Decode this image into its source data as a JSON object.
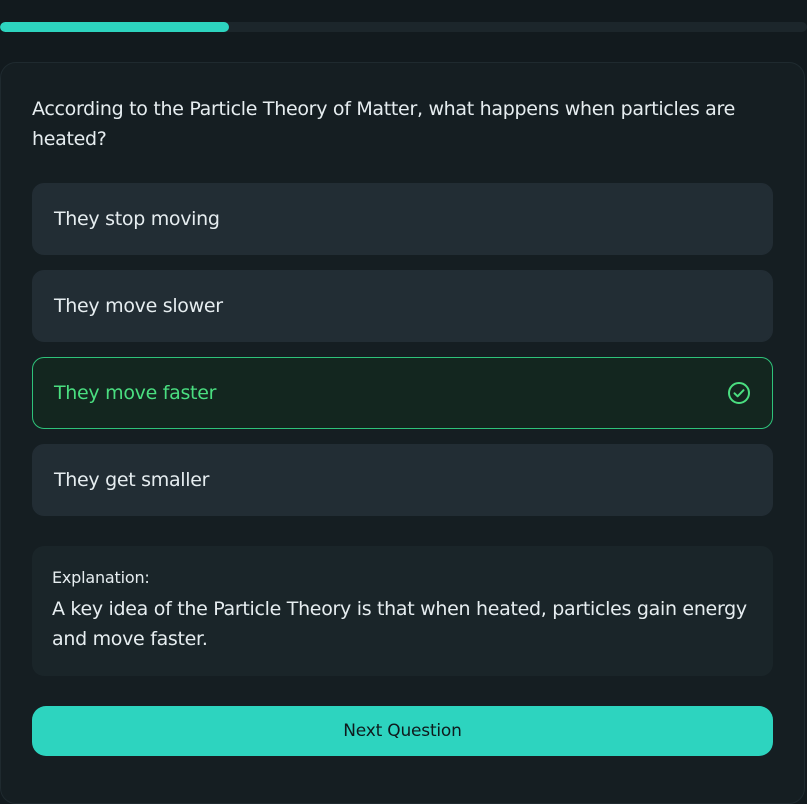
{
  "progress": {
    "fraction": 0.284,
    "color": "#2dd4bf"
  },
  "question": {
    "text": "According to the Particle Theory of Matter, what happens when particles are heated?"
  },
  "options": [
    {
      "label": "They stop moving",
      "state": "default"
    },
    {
      "label": "They move slower",
      "state": "default"
    },
    {
      "label": "They move faster",
      "state": "correct",
      "icon": "check-circle-icon"
    },
    {
      "label": "They get smaller",
      "state": "default"
    }
  ],
  "explanation": {
    "title": "Explanation:",
    "text": "A key idea of the Particle Theory is that when heated, particles gain energy and move faster."
  },
  "next_button": {
    "label": "Next Question"
  },
  "colors": {
    "accent": "#2dd4bf",
    "correct": "#4ade80",
    "background": "#121a1e"
  }
}
